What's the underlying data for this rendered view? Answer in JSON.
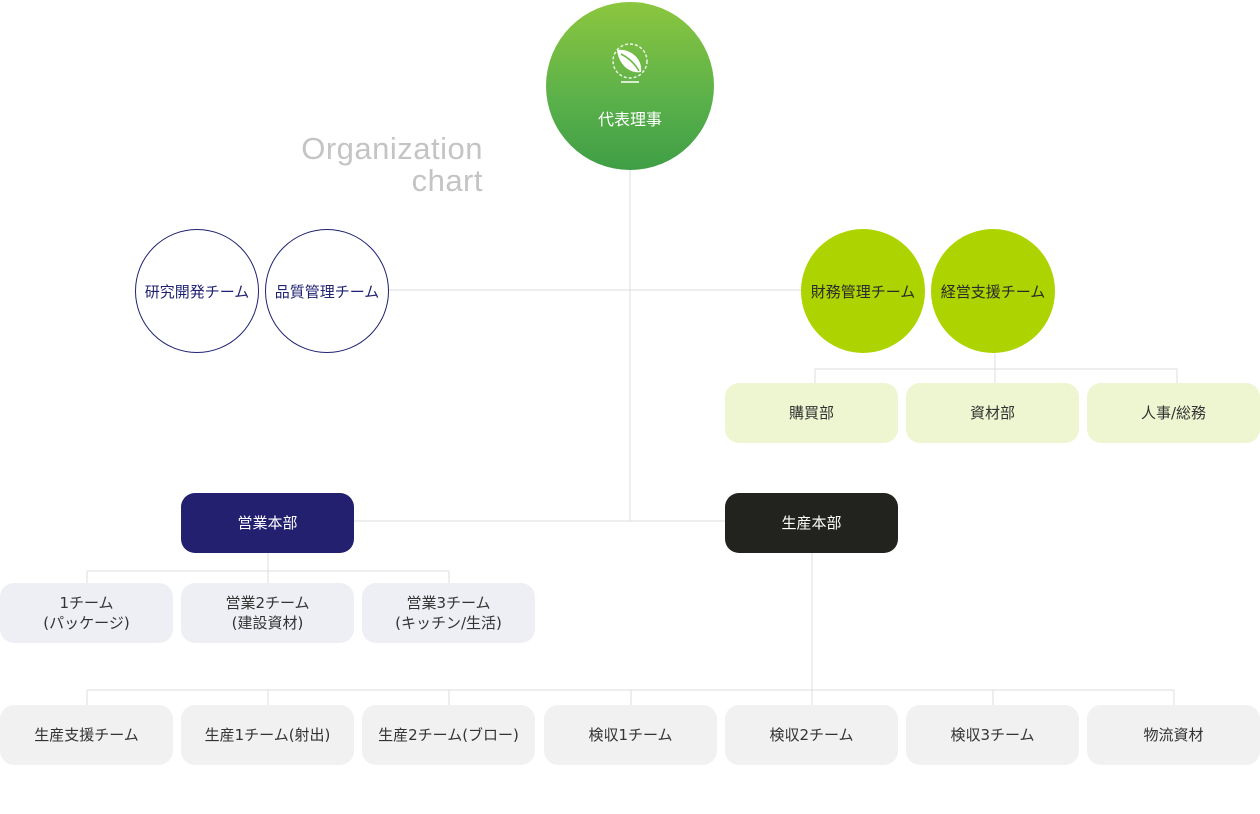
{
  "title": {
    "line1": "Organization",
    "line2": "chart"
  },
  "ceo": {
    "label": "代表理事"
  },
  "advisory": [
    {
      "label": "研究開発チーム"
    },
    {
      "label": "品質管理チーム"
    }
  ],
  "support": [
    {
      "label": "財務管理チーム"
    },
    {
      "label": "経営支援チーム"
    }
  ],
  "support_departments": [
    {
      "label": "購買部"
    },
    {
      "label": "資材部"
    },
    {
      "label": "人事/総務"
    }
  ],
  "divisions": {
    "sales": {
      "label": "営業本部"
    },
    "production": {
      "label": "生産本部"
    }
  },
  "sales_teams": [
    {
      "line1": "1チーム",
      "line2": "(パッケージ)"
    },
    {
      "line1": "営業2チーム",
      "line2": "(建設資材)"
    },
    {
      "line1": "営業3チーム",
      "line2": "(キッチン/生活)"
    }
  ],
  "production_teams": [
    {
      "label": "生産支援チーム"
    },
    {
      "label": "生産1チーム(射出)"
    },
    {
      "label": "生産2チーム(ブロー)"
    },
    {
      "label": "検収1チーム"
    },
    {
      "label": "検収2チーム"
    },
    {
      "label": "検収3チーム"
    },
    {
      "label": "物流資材"
    }
  ],
  "colors": {
    "ceo_gradient": [
      "#8cc63f",
      "#3f9e45"
    ],
    "lime": "#add300",
    "lime_light": "#eef5d1",
    "navy": "#23206f",
    "black": "#22221f",
    "lavender": "#eeeff5",
    "gray": "#f1f1f1",
    "connector": "#dddddd"
  },
  "icons": {
    "ceo_logo": "leaf-globe-logo-icon"
  }
}
